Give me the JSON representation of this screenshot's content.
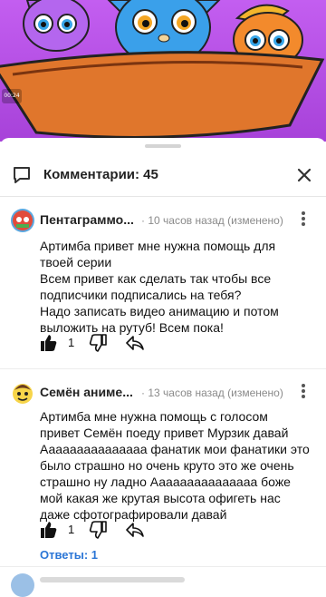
{
  "video": {
    "timecode": "00:24"
  },
  "comments_header": {
    "title": "Комментарии: 45"
  },
  "comments": [
    {
      "author": "Пентаграммо...",
      "meta": "· 10 часов назад (изменено)",
      "lines": [
        "Артимба привет мне нужна помощь для",
        "твоей серии",
        "Всем привет как сделать так чтобы все",
        "подписчики подписались на тебя?",
        "Надо записать видео анимацию и потом",
        "выложить на рутуб! Всем пока!"
      ],
      "likes": "1"
    },
    {
      "author": "Семён аниме...",
      "meta": "· 13 часов назад (изменено)",
      "lines": [
        "Артимба мне нужна помощь с голосом",
        "привет Семён поеду привет Мурзик давай",
        "Ааааааааааааааа фанатик мои фанатики это",
        "было страшно но очень круто это же очень",
        "страшно ну ладно Ааааааааааааааа боже",
        "мой какая же крутая высота офигеть нас",
        "даже сфотографировали давай"
      ],
      "likes": "1",
      "replies": "Ответы: 1"
    }
  ]
}
